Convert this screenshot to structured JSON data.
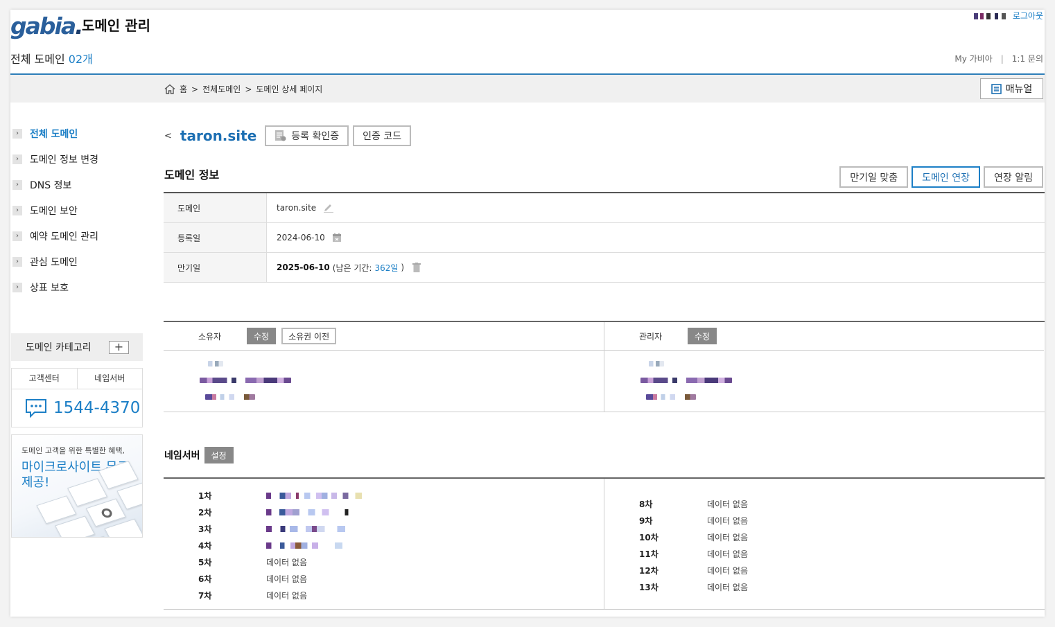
{
  "header": {
    "logo_text": "gabia",
    "logo_dot": ".",
    "title": "도메인 관리",
    "total_label": "전체 도메인",
    "total_count": "02개",
    "logout": "로그아웃",
    "my_gabia": "My 가비아",
    "separator": "|",
    "inquiry": "1:1 문의"
  },
  "breadcrumb": {
    "home": "홈",
    "sep": ">",
    "level1": "전체도메인",
    "level2": "도메인 상세 페이지"
  },
  "manual_button": "매뉴얼",
  "sidebar": {
    "items": [
      {
        "label": "전체 도메인",
        "active": true
      },
      {
        "label": "도메인 정보 변경"
      },
      {
        "label": "DNS 정보"
      },
      {
        "label": "도메인 보안"
      },
      {
        "label": "예약 도메인 관리"
      },
      {
        "label": "관심 도메인"
      },
      {
        "label": "상표 보호"
      }
    ],
    "category_label": "도메인 카테고리",
    "category_add": "+",
    "support_tabs": [
      "고객센터",
      "네임서버"
    ],
    "phone": "1544-4370",
    "promo_line1": "도메인 고객을 위한 특별한 혜택,",
    "promo_line2": "마이크로사이트 무료 제공!"
  },
  "domain": {
    "back": "<",
    "name": "taron.site",
    "btn_certificate": "등록 확인증",
    "btn_auth_code": "인증 코드"
  },
  "info": {
    "title": "도메인 정보",
    "actions": [
      "만기일 맞춤",
      "도메인 연장",
      "연장 알림"
    ],
    "rows": {
      "domain_label": "도메인",
      "domain_value": "taron.site",
      "reg_label": "등록일",
      "reg_value": "2024-06-10",
      "exp_label": "만기일",
      "exp_value": "2025-06-10",
      "remain_prefix": "(남은 기간:",
      "remain_value": "362일",
      "remain_suffix": ")"
    }
  },
  "owner": {
    "label": "소유자",
    "edit": "수정",
    "transfer": "소유권 이전"
  },
  "admin": {
    "label": "관리자",
    "edit": "수정"
  },
  "nameserver": {
    "title": "네임서버",
    "setting": "설정",
    "left": [
      {
        "n": "1차",
        "value": ""
      },
      {
        "n": "2차",
        "value": ""
      },
      {
        "n": "3차",
        "value": ""
      },
      {
        "n": "4차",
        "value": ""
      },
      {
        "n": "5차",
        "value": "데이터 없음"
      },
      {
        "n": "6차",
        "value": "데이터 없음"
      },
      {
        "n": "7차",
        "value": "데이터 없음"
      }
    ],
    "right": [
      {
        "n": "8차",
        "value": "데이터 없음"
      },
      {
        "n": "9차",
        "value": "데이터 없음"
      },
      {
        "n": "10차",
        "value": "데이터 없음"
      },
      {
        "n": "11차",
        "value": "데이터 없음"
      },
      {
        "n": "12차",
        "value": "데이터 없음"
      },
      {
        "n": "13차",
        "value": "데이터 없음"
      }
    ]
  },
  "colors": {
    "accent": "#1c7fc6",
    "header_rule": "#2d7eb8",
    "tag_grey": "#888888"
  }
}
